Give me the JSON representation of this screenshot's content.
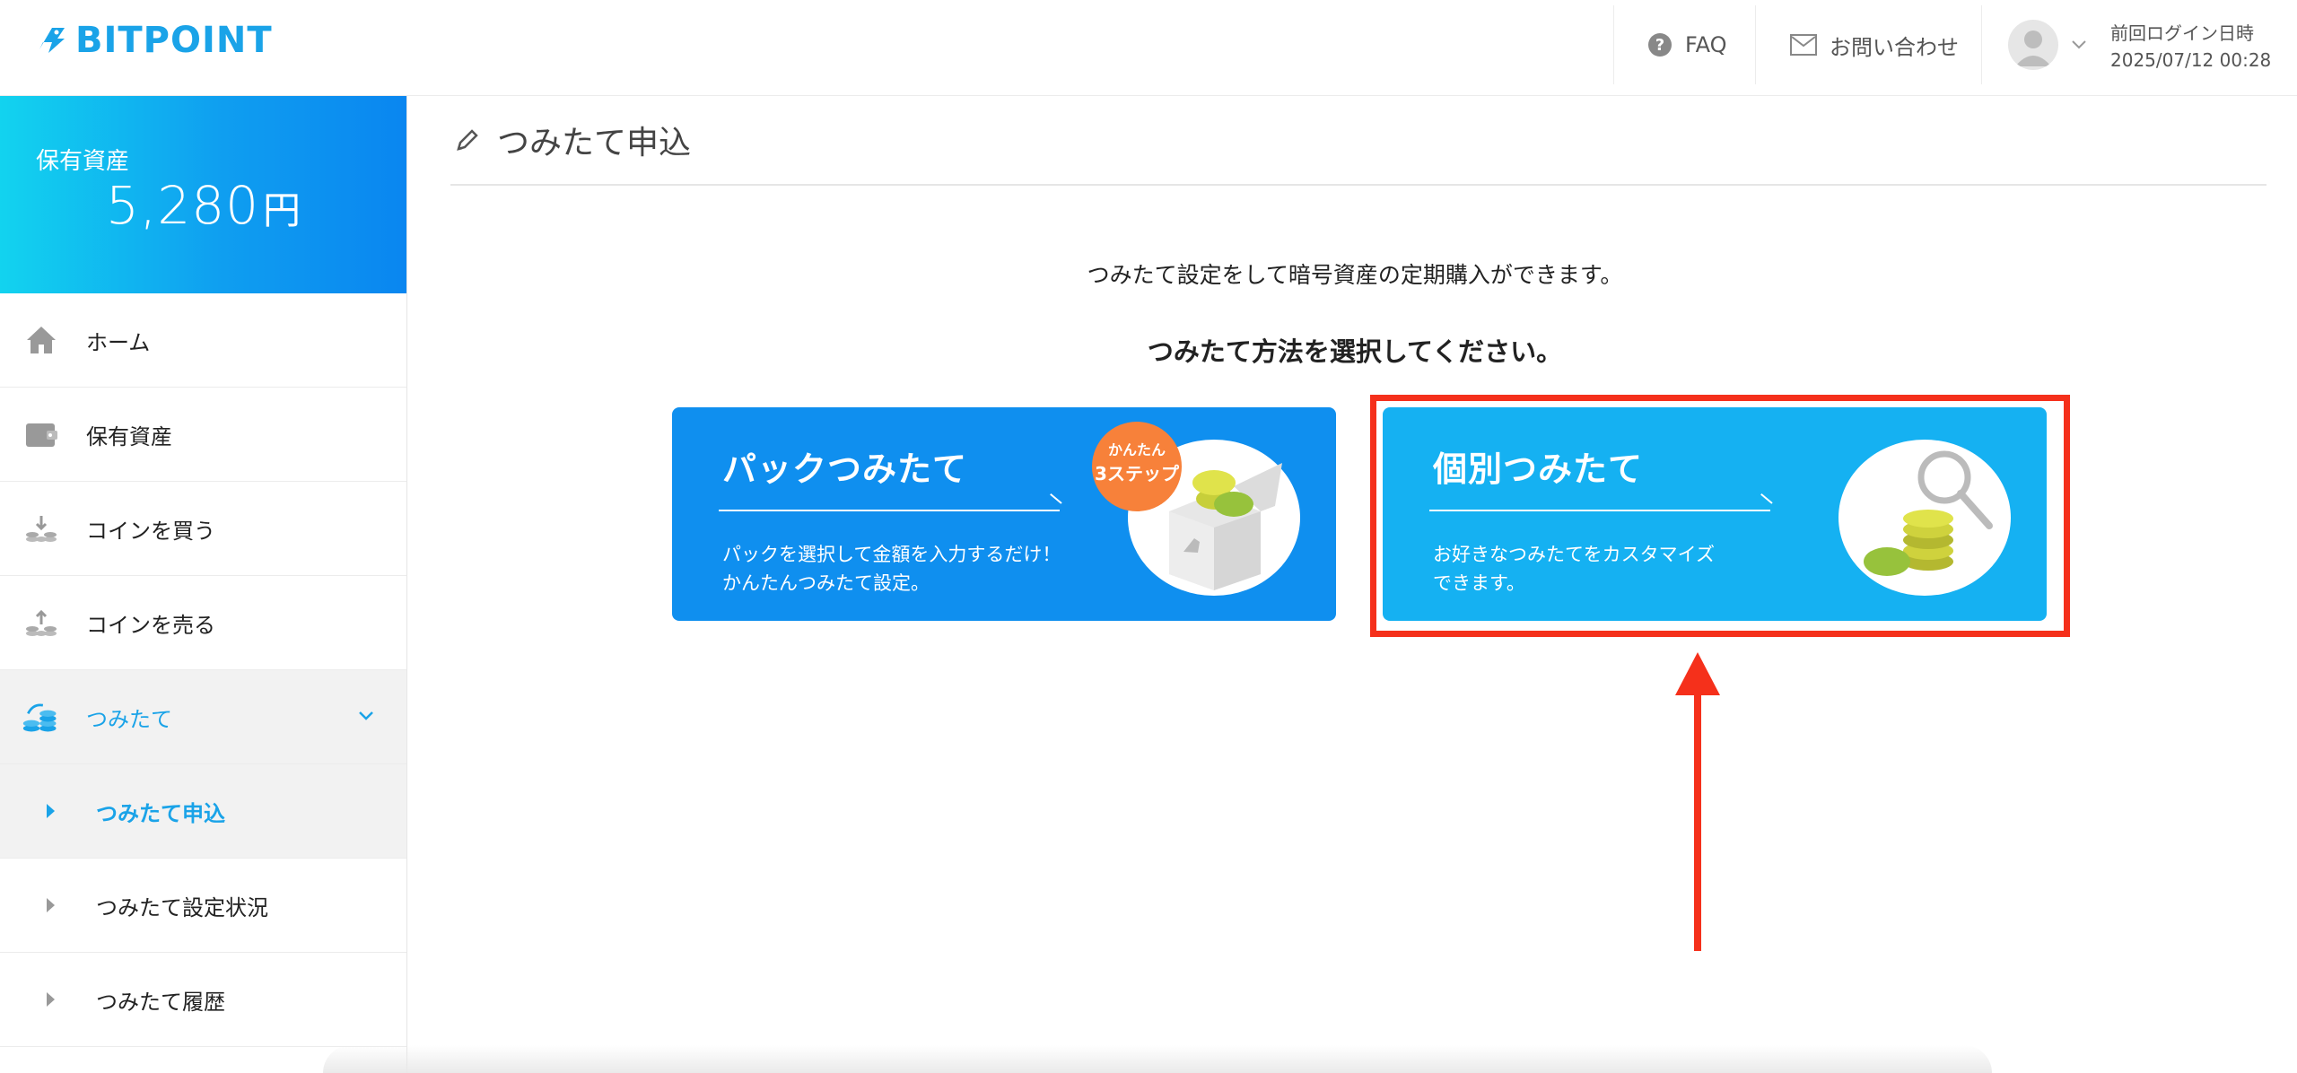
{
  "header": {
    "logo_text": "BITPOINT",
    "faq_label": "FAQ",
    "contact_label": "お問い合わせ",
    "last_login_label": "前回ログイン日時",
    "last_login_value": "2025/07/12 00:28"
  },
  "sidebar": {
    "asset_label": "保有資産",
    "asset_value": "5,280",
    "asset_unit": "円",
    "items": [
      {
        "label": "ホーム",
        "icon": "home-icon"
      },
      {
        "label": "保有資産",
        "icon": "wallet-icon"
      },
      {
        "label": "コインを買う",
        "icon": "coin-buy-icon"
      },
      {
        "label": "コインを売る",
        "icon": "coin-sell-icon"
      },
      {
        "label": "つみたて",
        "icon": "coin-stack-icon"
      }
    ],
    "sub_items": [
      {
        "label": "つみたて申込"
      },
      {
        "label": "つみたて設定状況"
      },
      {
        "label": "つみたて履歴"
      }
    ]
  },
  "main": {
    "page_title": "つみたて申込",
    "intro": "つみたて設定をして暗号資産の定期購入ができます。",
    "select_msg": "つみたて方法を選択してください。",
    "cards": [
      {
        "title": "パックつみたて",
        "desc_line1": "パックを選択して金額を入力するだけ！",
        "desc_line2": "かんたんつみたて設定。",
        "badge_line1": "かんたん",
        "badge_line2": "3ステップ"
      },
      {
        "title": "個別つみたて",
        "desc_line1": "お好きなつみたてをカスタマイズ",
        "desc_line2": "できます。"
      }
    ]
  },
  "colors": {
    "brand": "#1aa3e8",
    "pack_card": "#0f8fef",
    "individual_card": "#15b1f2",
    "highlight": "#f5301b",
    "badge": "#f7813a"
  }
}
